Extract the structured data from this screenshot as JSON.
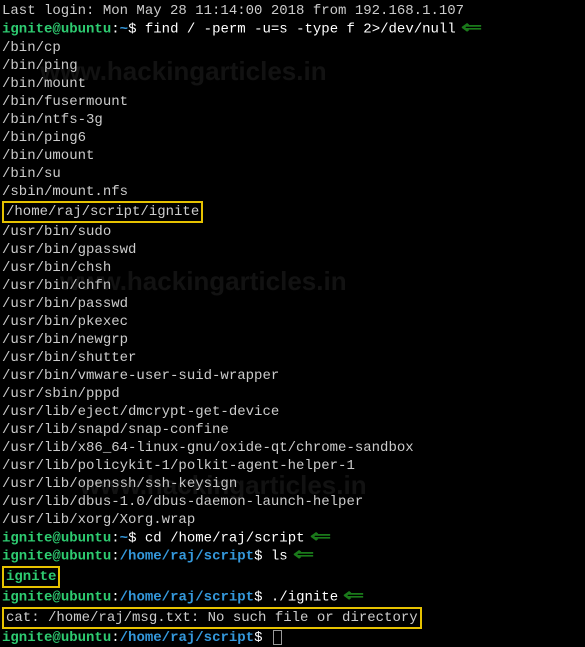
{
  "lastLogin": "Last login: Mon May 28 11:14:00 2018 from 192.168.1.107",
  "prompt": {
    "user": "ignite",
    "at": "@",
    "host": "ubuntu",
    "colon": ":",
    "homePath": "~",
    "scriptPath": "/home/raj/script",
    "dollar": "$"
  },
  "cmd1": "find / -perm -u=s -type f 2>/dev/null",
  "findOutput": [
    "/bin/cp",
    "/bin/ping",
    "/bin/mount",
    "/bin/fusermount",
    "/bin/ntfs-3g",
    "/bin/ping6",
    "/bin/umount",
    "/bin/su",
    "/sbin/mount.nfs",
    "/home/raj/script/ignite",
    "/usr/bin/sudo",
    "/usr/bin/gpasswd",
    "/usr/bin/chsh",
    "/usr/bin/chfn",
    "/usr/bin/passwd",
    "/usr/bin/pkexec",
    "/usr/bin/newgrp",
    "/usr/bin/shutter",
    "/usr/bin/vmware-user-suid-wrapper",
    "/usr/sbin/pppd",
    "/usr/lib/eject/dmcrypt-get-device",
    "/usr/lib/snapd/snap-confine",
    "/usr/lib/x86_64-linux-gnu/oxide-qt/chrome-sandbox",
    "/usr/lib/policykit-1/polkit-agent-helper-1",
    "/usr/lib/openssh/ssh-keysign",
    "/usr/lib/dbus-1.0/dbus-daemon-launch-helper",
    "/usr/lib/xorg/Xorg.wrap"
  ],
  "highlightIndex": 9,
  "cmd2": "cd /home/raj/script",
  "cmd3": "ls",
  "lsOutput": "ignite",
  "cmd4": "./ignite",
  "catError": "cat: /home/raj/msg.txt: No such file or directory",
  "watermark": "www.hackingarticles.in",
  "arrow": "⇐"
}
